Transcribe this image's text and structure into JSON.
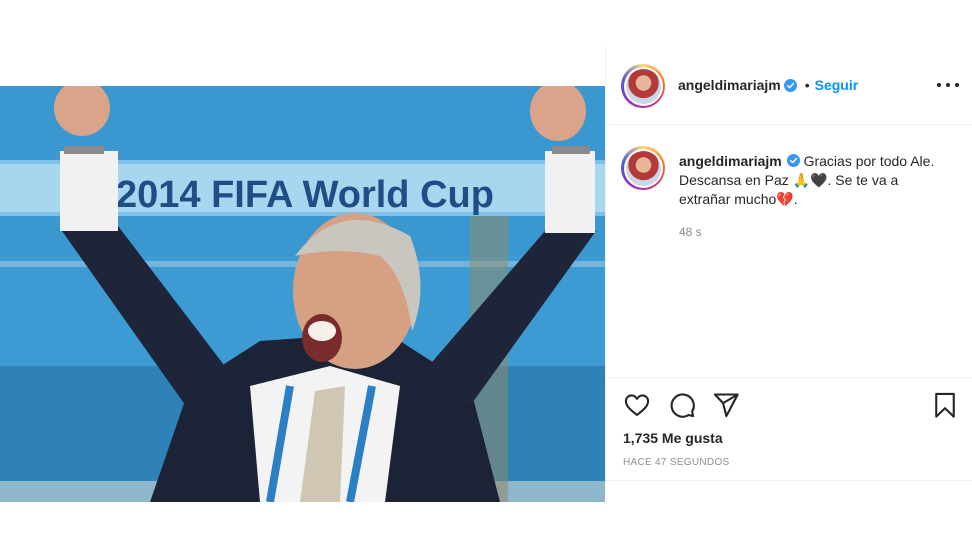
{
  "post": {
    "username": "angeldimariajm",
    "follow_label": "Seguir",
    "dot": "•",
    "caption": "Gracias por todo Ale. Descansa en Paz 🙏🖤. Se te va a extrañar mucho💔.",
    "comment_age": "48 s",
    "likes": "1,735 Me gusta",
    "posted": "HACE 47 SEGUNDOS",
    "banner_text": "2014 FIFA World Cup"
  },
  "colors": {
    "link": "#0095f6",
    "verified": "#3897f0",
    "text": "#262626",
    "muted": "#8e8e8e"
  },
  "icons": {
    "like": "heart-icon",
    "comment": "comment-bubble-icon",
    "share": "paper-plane-icon",
    "save": "bookmark-icon",
    "more": "more-options-icon",
    "verified": "verified-badge-icon"
  }
}
